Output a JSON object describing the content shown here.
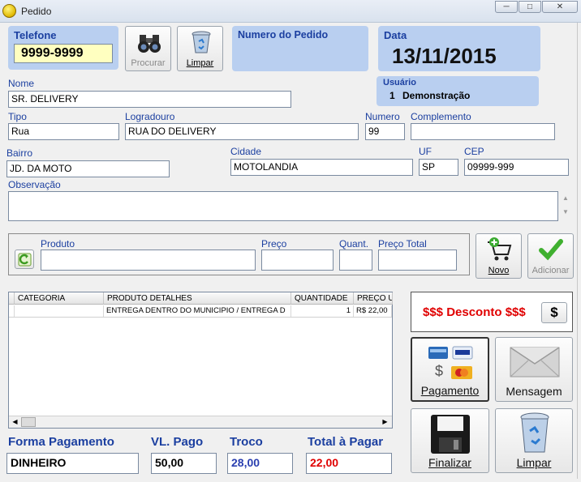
{
  "window": {
    "title": "Pedido"
  },
  "header": {
    "telefone_label": "Telefone",
    "telefone_value": "9999-9999",
    "procurar_label": "Procurar",
    "limpar_label": "Limpar",
    "numero_pedido_label": "Numero do Pedido",
    "numero_pedido_value": "",
    "data_label": "Data",
    "data_value": "13/11/2015",
    "usuario_label": "Usuário",
    "usuario_id": "1",
    "usuario_name": "Demonstração"
  },
  "cliente": {
    "nome_label": "Nome",
    "nome_value": "SR. DELIVERY",
    "tipo_label": "Tipo",
    "tipo_value": "Rua",
    "logradouro_label": "Logradouro",
    "logradouro_value": "RUA DO DELIVERY",
    "numero_label": "Numero",
    "numero_value": "99",
    "complemento_label": "Complemento",
    "complemento_value": "",
    "bairro_label": "Bairro",
    "bairro_value": "JD. DA MOTO",
    "cidade_label": "Cidade",
    "cidade_value": "MOTOLANDIA",
    "uf_label": "UF",
    "uf_value": "SP",
    "cep_label": "CEP",
    "cep_value": "09999-999",
    "observacao_label": "Observação",
    "observacao_value": ""
  },
  "produto": {
    "produto_label": "Produto",
    "preco_label": "Preço",
    "quant_label": "Quant.",
    "preco_total_label": "Preço Total",
    "novo_label": "Novo",
    "adicionar_label": "Adicionar"
  },
  "grid": {
    "columns": [
      "CATEGORIA",
      "PRODUTO DETALHES",
      "QUANTIDADE",
      "PREÇO U"
    ],
    "rows": [
      {
        "categoria": "",
        "detalhes": "ENTREGA DENTRO DO MUNICIPIO / ENTREGA D",
        "quantidade": "1",
        "preco": "R$ 22,00"
      }
    ]
  },
  "actions": {
    "desconto_label": "$$$ Desconto $$$",
    "desconto_button": "$",
    "pagamento_label": "Pagamento",
    "mensagem_label": "Mensagem",
    "finalizar_label": "Finalizar",
    "limpar_label": "Limpar"
  },
  "totais": {
    "forma_label": "Forma Pagamento",
    "forma_value": "DINHEIRO",
    "pago_label": "VL. Pago",
    "pago_value": "50,00",
    "troco_label": "Troco",
    "troco_value": "28,00",
    "total_label": "Total à Pagar",
    "total_value": "22,00"
  },
  "colors": {
    "panel": "#b9cff0",
    "label_blue": "#1b3fa0",
    "discount_red": "#e00000",
    "troco_blue": "#2a3fb0"
  }
}
